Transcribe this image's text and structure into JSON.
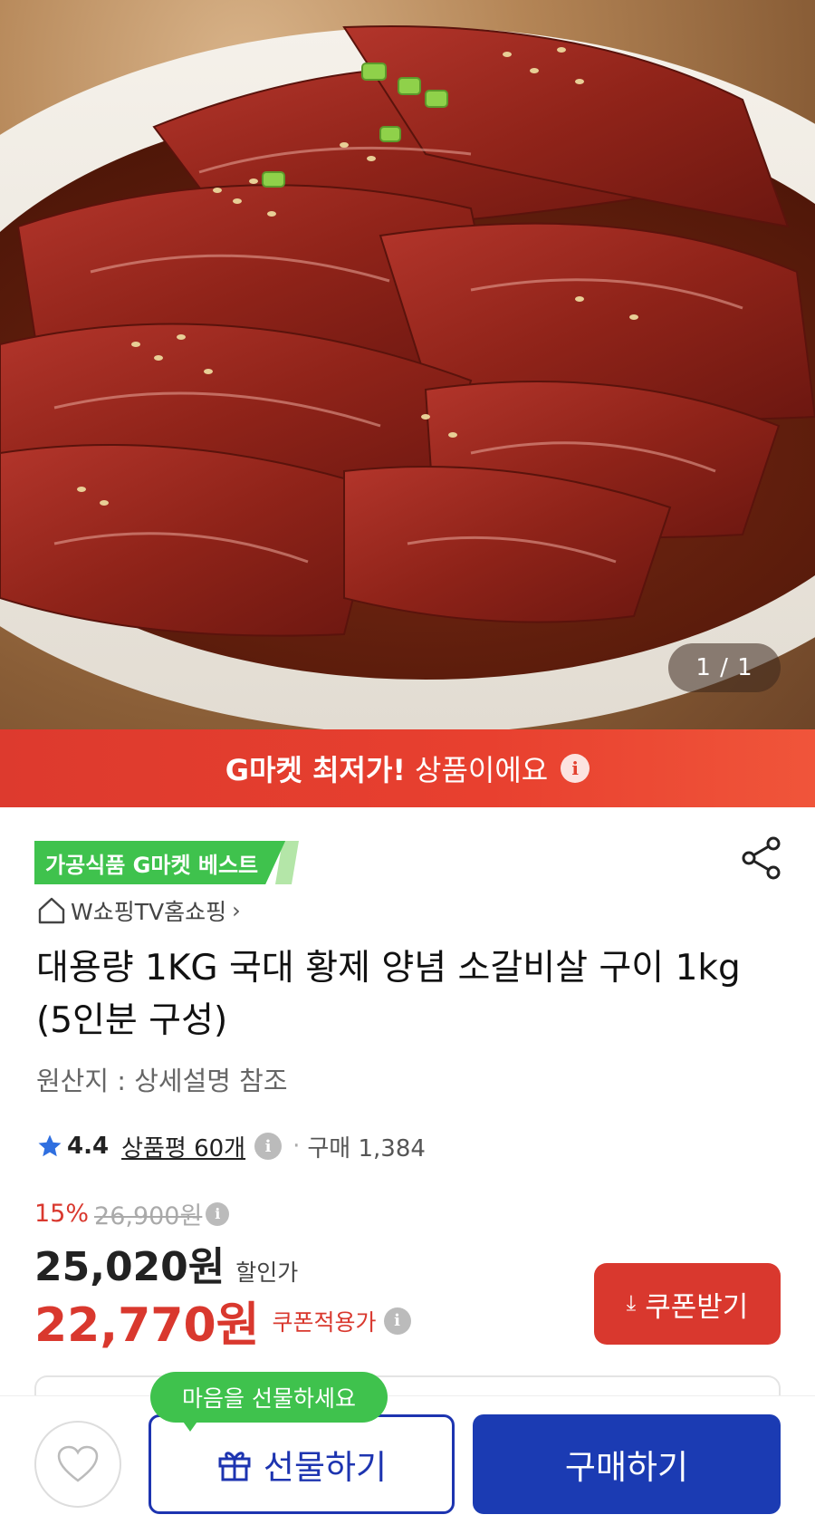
{
  "gallery": {
    "counter": "1 / 1"
  },
  "banner": {
    "strong": "G마켓 최저가!",
    "text": "상품이에요",
    "info_icon": "info-icon"
  },
  "product": {
    "badge": "가공식품 G마켓 베스트",
    "seller": "W쇼핑TV홈쇼핑",
    "title": "대용량 1KG 국대 황제 양념 소갈비살 구이 1kg (5인분 구성)",
    "origin": "원산지 : 상세설명 참조",
    "rating": {
      "score": "4.4",
      "reviews": "상품평 60개",
      "purchases": "구매 1,384",
      "stars": 4.4
    },
    "price": {
      "discount_pct": "15%",
      "original": "26,900원",
      "sale": "25,020원",
      "sale_label": "할인가",
      "coupon": "22,770원",
      "coupon_label": "쿠폰적용가"
    }
  },
  "actions": {
    "coupon_button": "쿠폰받기",
    "gift_tooltip": "마음을 선물하세요",
    "gift_button": "선물하기",
    "buy_button": "구매하기"
  },
  "colors": {
    "accent_red": "#d9382e",
    "brand_blue": "#1b3bb3",
    "best_green": "#3fc24d"
  }
}
